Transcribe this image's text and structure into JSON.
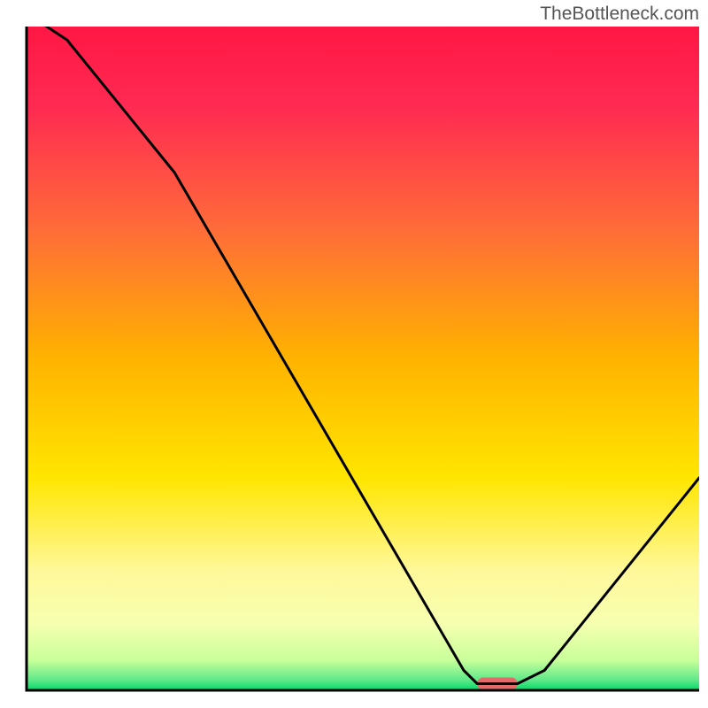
{
  "watermark": "TheBottleneck.com",
  "chart_data": {
    "type": "line",
    "title": "",
    "xlabel": "",
    "ylabel": "",
    "xlim": [
      0,
      100
    ],
    "ylim": [
      0,
      100
    ],
    "x": [
      0,
      6,
      22,
      65,
      67,
      73,
      77,
      100
    ],
    "values": [
      102,
      98,
      78,
      3,
      1,
      1,
      3,
      32
    ],
    "marker": {
      "x_start": 67,
      "x_end": 73,
      "y": 1
    },
    "gradient_stops": [
      {
        "offset": 0.0,
        "color": "#ff1744"
      },
      {
        "offset": 0.12,
        "color": "#ff2a52"
      },
      {
        "offset": 0.3,
        "color": "#ff6a3a"
      },
      {
        "offset": 0.5,
        "color": "#ffb300"
      },
      {
        "offset": 0.68,
        "color": "#ffe600"
      },
      {
        "offset": 0.82,
        "color": "#fff89a"
      },
      {
        "offset": 0.9,
        "color": "#f6ffb0"
      },
      {
        "offset": 0.955,
        "color": "#c8ff9a"
      },
      {
        "offset": 0.985,
        "color": "#5de88a"
      },
      {
        "offset": 1.0,
        "color": "#00d965"
      }
    ],
    "axis_color": "#000000",
    "line_color": "#000000",
    "marker_color": "#e46a6a"
  }
}
